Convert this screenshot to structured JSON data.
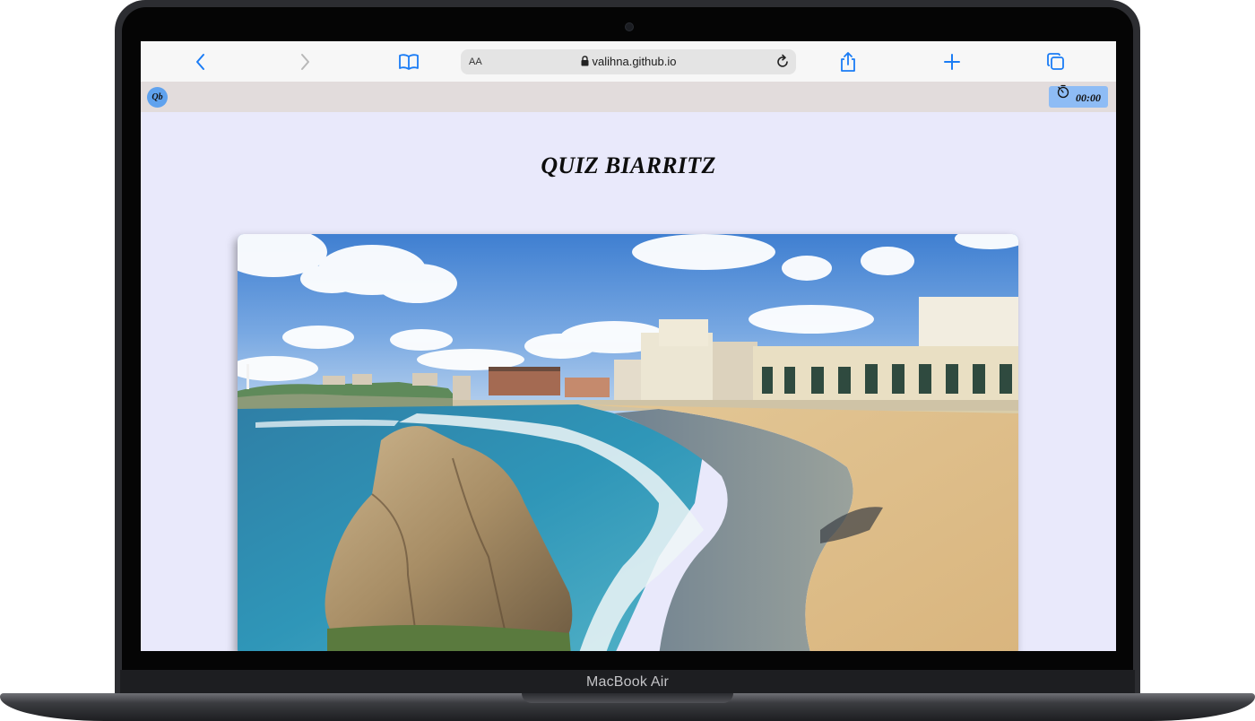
{
  "device": {
    "model_label": "MacBook Air"
  },
  "browser": {
    "address_bar": {
      "text_size_label": "AA",
      "url": "valihna.github.io"
    },
    "toolbar_icons": [
      "back-icon",
      "forward-icon",
      "bookmarks-icon",
      "lock-icon",
      "reload-icon",
      "share-icon",
      "new-tab-icon",
      "tabs-icon"
    ]
  },
  "app": {
    "logo_text": "Qb",
    "timer": {
      "value": "00:00",
      "icon": "stopwatch-icon"
    },
    "title": "QUIZ BIARRITZ",
    "hero_image": {
      "icon": "biarritz-beach-photo"
    }
  },
  "colors": {
    "page_bg": "#e9e9fb",
    "header_bg": "#e2dcdc",
    "logo_bg": "#5fa2ee",
    "timer_bg": "#8ebcf5",
    "safari_accent": "#1a7cf5"
  }
}
